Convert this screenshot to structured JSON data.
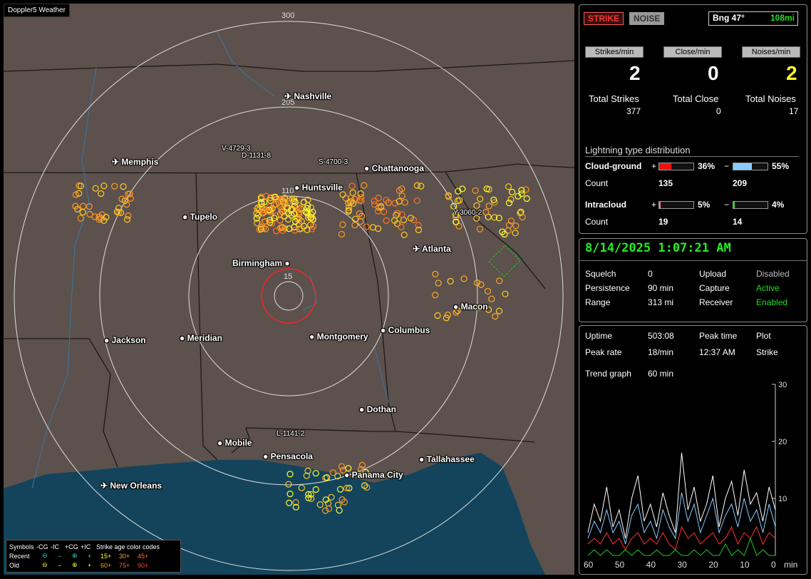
{
  "map": {
    "title": "Doppler5 Weather",
    "ring_labels": [
      "300",
      "205",
      "110",
      "15"
    ],
    "cities": [
      "Nashville",
      "Memphis",
      "Chattanooga",
      "Huntsville",
      "Tupelo",
      "Atlanta",
      "Birmingham",
      "Macon",
      "Jackson",
      "Meridian",
      "Montgomery",
      "Columbus",
      "Dothan",
      "Mobile",
      "Pensacola",
      "Panama City",
      "Tallahassee",
      "New Orleans"
    ],
    "storm_labels": [
      "V-4729-3",
      "D-1131-8",
      "S-4700-3",
      "Y-3060-2",
      "L-1141-2"
    ],
    "legend": {
      "header": [
        "Symbols",
        "-CG",
        "-IC",
        "+CG",
        "+IC",
        "Strike age color codes"
      ],
      "recent": [
        "Recent",
        "15+",
        "30+",
        "45+"
      ],
      "old": [
        "Old",
        "60+",
        "75+",
        "90+"
      ]
    }
  },
  "top": {
    "strike_btn": "STRIKE",
    "noise_btn": "NOISE",
    "bearing": "Bng 47°",
    "distance": "108mi",
    "rate_labels": [
      "Strikes/min",
      "Close/min",
      "Noises/min"
    ],
    "rates": [
      "2",
      "0",
      "2"
    ],
    "total_labels": [
      "Total Strikes",
      "Total Close",
      "Total Noises"
    ],
    "totals": [
      "377",
      "0",
      "17"
    ],
    "dist_title": "Lightning type distribution",
    "cg_label": "Cloud-ground",
    "ic_label": "Intracloud",
    "count_label": "Count",
    "plus": "+",
    "minus": "−",
    "cg_pos_pct": "36%",
    "cg_neg_pct": "55%",
    "ic_pos_pct": "5%",
    "ic_neg_pct": "4%",
    "cg_pos_count": "135",
    "cg_neg_count": "209",
    "ic_pos_count": "19",
    "ic_neg_count": "14",
    "cg_pos_frac": 0.36,
    "cg_neg_frac": 0.55,
    "ic_pos_frac": 0.05,
    "ic_neg_frac": 0.04
  },
  "status": {
    "datetime": "8/14/2025 1:07:21 AM",
    "squelch_label": "Squelch",
    "squelch": "0",
    "persistence_label": "Persistence",
    "persistence": "90 min",
    "range_label": "Range",
    "range": "313 mi",
    "upload_label": "Upload",
    "upload": "Disabled",
    "capture_label": "Capture",
    "capture": "Active",
    "receiver_label": "Receiver",
    "receiver": "Enabled"
  },
  "stats": {
    "uptime_label": "Uptime",
    "uptime": "503:08",
    "peak_time_label": "Peak time",
    "plot_label": "Plot",
    "peak_rate_label": "Peak rate",
    "peak_rate": "18/min",
    "peak_time": "12:37 AM",
    "plot": "Strike",
    "trend_label": "Trend graph",
    "trend": "60 min"
  },
  "chart_data": {
    "type": "line",
    "x_ticks": [
      "60",
      "50",
      "40",
      "30",
      "20",
      "10",
      "0"
    ],
    "xlabel": "min",
    "y_ticks": [
      "30",
      "20",
      "10"
    ],
    "ylim": [
      0,
      30
    ],
    "x": [
      60,
      58,
      56,
      54,
      52,
      50,
      48,
      46,
      44,
      42,
      40,
      38,
      36,
      34,
      32,
      30,
      28,
      26,
      24,
      22,
      20,
      18,
      16,
      14,
      12,
      10,
      8,
      6,
      4,
      2,
      0
    ],
    "series": [
      {
        "color": "#ffffff",
        "values": [
          4,
          9,
          6,
          12,
          5,
          8,
          3,
          10,
          14,
          6,
          9,
          5,
          11,
          7,
          4,
          18,
          8,
          12,
          6,
          9,
          14,
          5,
          10,
          13,
          7,
          15,
          9,
          11,
          6,
          12,
          8
        ]
      },
      {
        "color": "#88ccff",
        "values": [
          3,
          6,
          4,
          8,
          4,
          6,
          2,
          7,
          9,
          4,
          6,
          3,
          8,
          5,
          3,
          11,
          6,
          9,
          4,
          7,
          10,
          4,
          7,
          9,
          5,
          10,
          6,
          8,
          4,
          9,
          5
        ]
      },
      {
        "color": "#ff3333",
        "values": [
          2,
          3,
          2,
          4,
          2,
          3,
          1,
          3,
          4,
          2,
          3,
          2,
          4,
          2,
          1,
          5,
          3,
          4,
          2,
          3,
          4,
          2,
          3,
          5,
          2,
          4,
          3,
          5,
          2,
          4,
          3
        ]
      },
      {
        "color": "#22cc22",
        "values": [
          0,
          1,
          0,
          1,
          0,
          0,
          1,
          0,
          1,
          0,
          0,
          1,
          0,
          0,
          1,
          0,
          0,
          1,
          0,
          1,
          0,
          0,
          2,
          0,
          1,
          0,
          3,
          0,
          1,
          0,
          0
        ]
      }
    ]
  }
}
